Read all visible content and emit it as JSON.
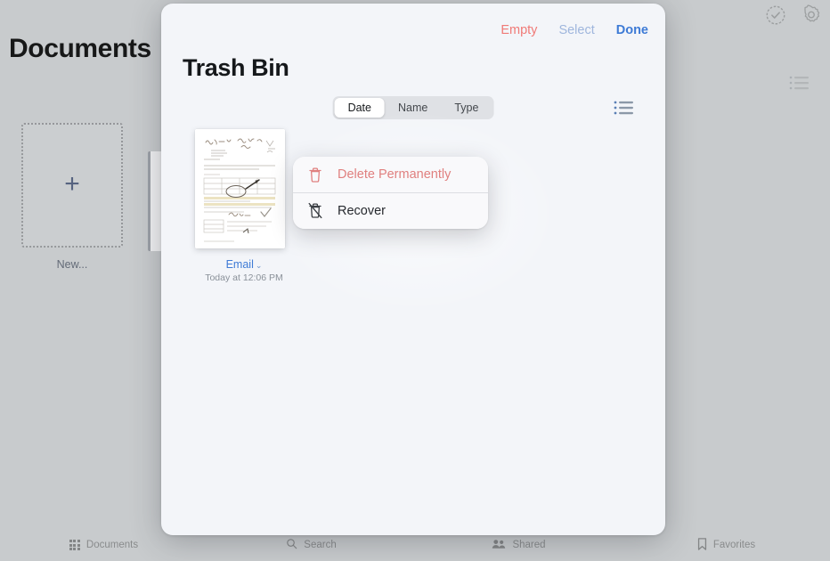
{
  "background": {
    "title": "Documents",
    "topright_icons": [
      {
        "name": "select-circle-icon",
        "glyph": "check-badge"
      },
      {
        "name": "settings-gear-icon",
        "glyph": "gear"
      }
    ],
    "new_tile": {
      "plus": "+",
      "label": "New..."
    },
    "list_view_icon": "list-bullet-icon",
    "tabs": [
      {
        "label": "Documents",
        "icon": "grid-icon"
      },
      {
        "label": "Search",
        "icon": "magnifier-icon"
      },
      {
        "label": "Shared",
        "icon": "people-icon"
      },
      {
        "label": "Favorites",
        "icon": "bookmark-icon"
      }
    ]
  },
  "sheet": {
    "title": "Trash Bin",
    "actions": {
      "empty": "Empty",
      "select": "Select",
      "done": "Done"
    },
    "sort_segments": [
      {
        "label": "Date",
        "selected": true
      },
      {
        "label": "Name",
        "selected": false
      },
      {
        "label": "Type",
        "selected": false
      }
    ],
    "list_view_icon": "list-bullet-icon",
    "documents": [
      {
        "label": "Email",
        "chevron": "⌄",
        "date": "Today at 12:06 PM"
      }
    ]
  },
  "context_menu": {
    "items": [
      {
        "label": "Delete Permanently",
        "icon": "trash-icon",
        "destructive": true
      },
      {
        "label": "Recover",
        "icon": "trash-slash-icon",
        "destructive": false
      }
    ]
  },
  "colors": {
    "destructive": "#e0807f",
    "accent_blue": "#3e7bd6",
    "muted_blue": "#9fb6dd",
    "sheet_bg": "#f3f5f9",
    "backdrop": "#c8cbcd"
  }
}
